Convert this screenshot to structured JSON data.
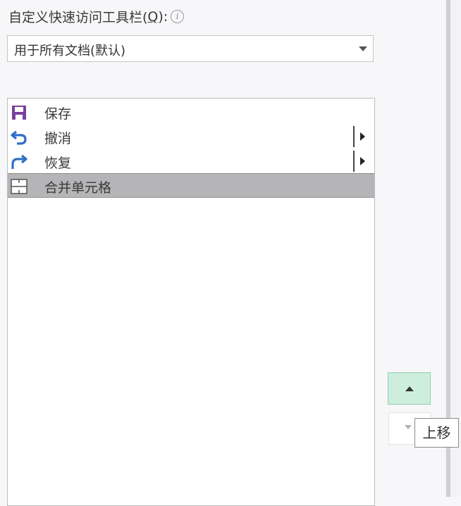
{
  "header": {
    "title_prefix": "自定义快速访问工具栏(",
    "title_key": "Q",
    "title_suffix": "):",
    "info_icon": "info-icon"
  },
  "dropdown": {
    "value": "用于所有文档(默认)"
  },
  "list": {
    "items": [
      {
        "label": "保存",
        "icon": "save-icon",
        "has_submenu": false,
        "selected": false
      },
      {
        "label": "撤消",
        "icon": "undo-icon",
        "has_submenu": true,
        "selected": false
      },
      {
        "label": "恢复",
        "icon": "redo-icon",
        "has_submenu": true,
        "selected": false
      },
      {
        "label": "合并单元格",
        "icon": "merge-cells-icon",
        "has_submenu": false,
        "selected": true
      }
    ]
  },
  "buttons": {
    "move_up_icon": "triangle-up-icon",
    "move_down_icon": "triangle-down-icon"
  },
  "tooltip": {
    "text": "上移"
  },
  "colors": {
    "save_icon": "#7b3f9e",
    "arrow_icon": "#2f6fc6",
    "selected_row": "#b5b5b7",
    "move_up_bg": "#cdeedd"
  }
}
